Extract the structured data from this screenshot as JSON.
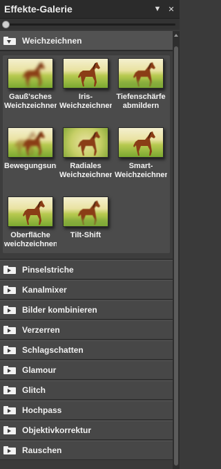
{
  "panel": {
    "title": "Effekte-Galerie"
  },
  "categories": {
    "expanded": {
      "label": "Weichzeichnen",
      "effects": [
        {
          "line1": "Gauß'sches",
          "line2": "Weichzeichner"
        },
        {
          "line1": "Iris-",
          "line2": "Weichzeichner"
        },
        {
          "line1": "Tiefenschärfe",
          "line2": "abmildern"
        },
        {
          "line1": "Bewegungsunschärfe",
          "line2": ""
        },
        {
          "line1": "Radiales",
          "line2": "Weichzeichner"
        },
        {
          "line1": "Smart-",
          "line2": "Weichzeichner"
        },
        {
          "line1": "Oberfläche",
          "line2": "weichzeichnen"
        },
        {
          "line1": "Tilt-Shift",
          "line2": ""
        }
      ]
    },
    "collapsed": [
      "Pinselstriche",
      "Kanalmixer",
      "Bilder kombinieren",
      "Verzerren",
      "Schlagschatten",
      "Glamour",
      "Glitch",
      "Hochpass",
      "Objektivkorrektur",
      "Rauschen"
    ]
  },
  "icons": {
    "menu": "chevron-down-icon",
    "close": "close-icon",
    "folder": "folder-icon"
  },
  "colors": {
    "panel_bg": "#3a3a3a",
    "header_bg": "#474747",
    "text": "#f0f0f0"
  }
}
